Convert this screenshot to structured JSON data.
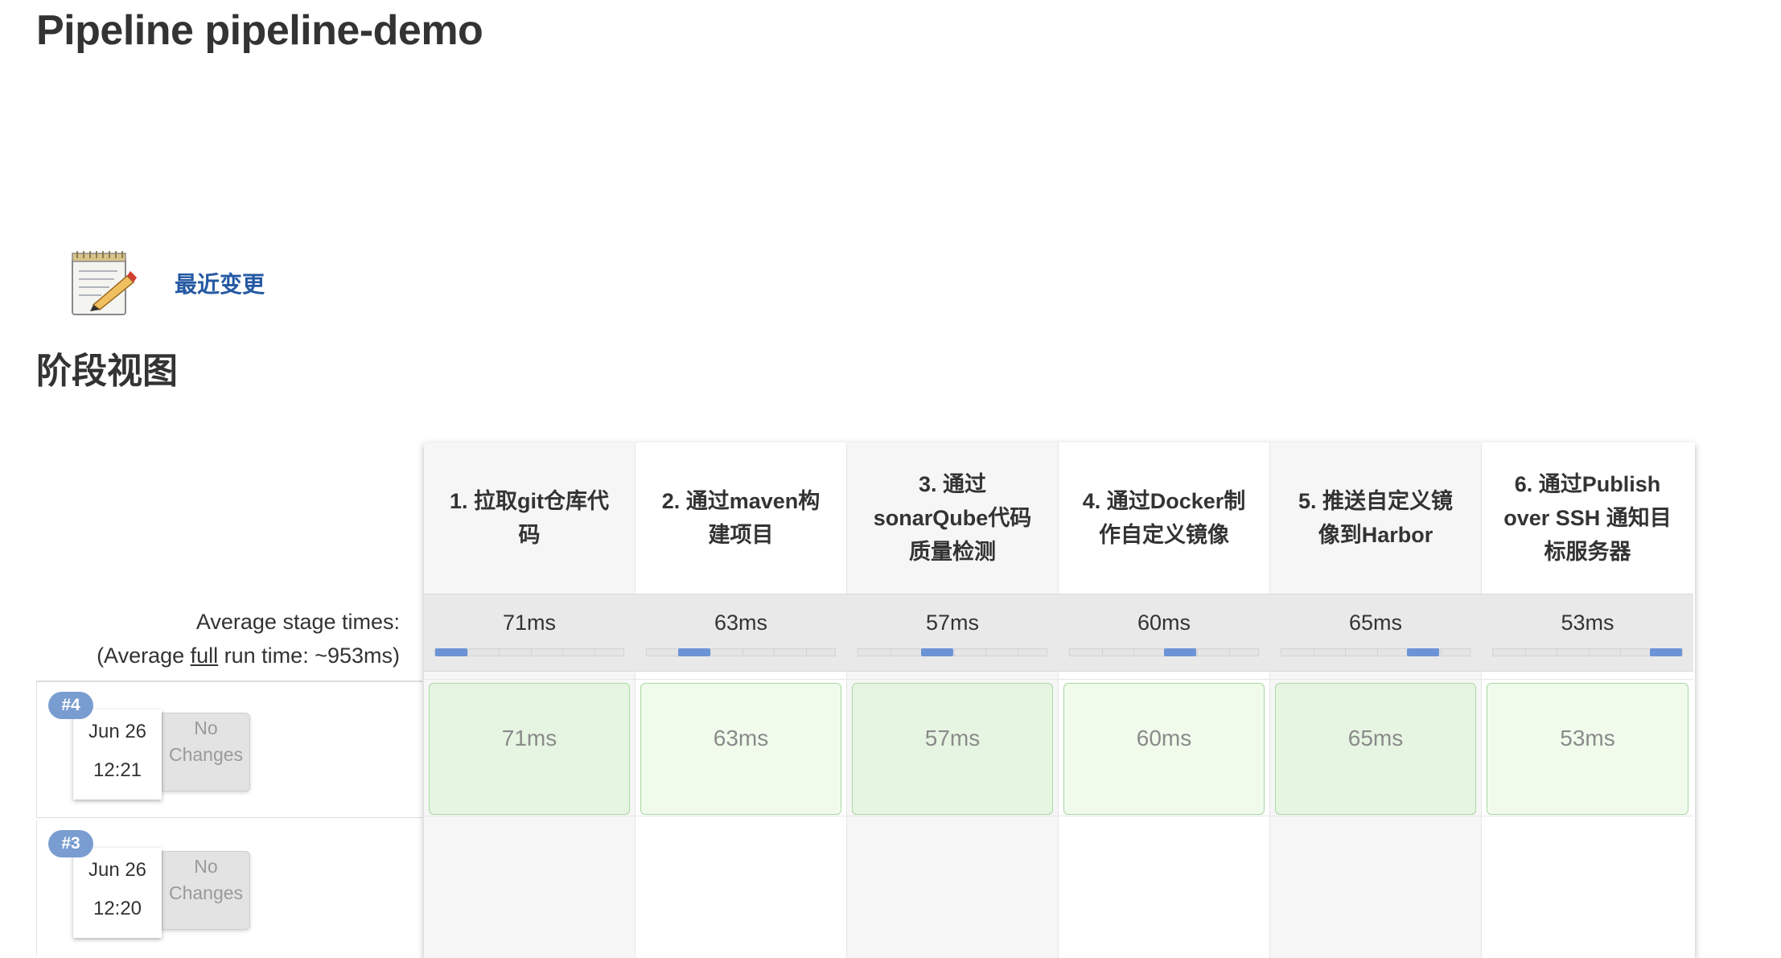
{
  "title": "Pipeline pipeline-demo",
  "recent_changes": {
    "label": "最近变更",
    "icon": "notepad-icon"
  },
  "stage_view": {
    "heading": "阶段视图",
    "avg_stage_label": "Average stage times:",
    "avg_full_prefix": "(Average ",
    "avg_full_link": "full",
    "avg_full_suffix": " run time: ~953ms)",
    "stages": [
      {
        "name": "1. 拉取git仓库代码",
        "avg": "71ms",
        "progress_pos": 0.0
      },
      {
        "name": "2. 通过maven构建项目",
        "avg": "63ms",
        "progress_pos": 0.2
      },
      {
        "name": "3. 通过sonarQube代码质量检测",
        "avg": "57ms",
        "progress_pos": 0.4
      },
      {
        "name": "4. 通过Docker制作自定义镜像",
        "avg": "60ms",
        "progress_pos": 0.6
      },
      {
        "name": "5. 推送自定义镜像到Harbor",
        "avg": "65ms",
        "progress_pos": 0.8
      },
      {
        "name": "6. 通过Publish over SSH 通知目标服务器",
        "avg": "53ms",
        "progress_pos": 1.0
      }
    ],
    "runs": [
      {
        "id": "#4",
        "date": "Jun 26",
        "time": "12:21",
        "changes": "No Changes",
        "durations": [
          "71ms",
          "63ms",
          "57ms",
          "60ms",
          "65ms",
          "53ms"
        ]
      },
      {
        "id": "#3",
        "date": "Jun 26",
        "time": "12:20",
        "changes": "No Changes",
        "durations": [
          "",
          "",
          "",
          "",
          "",
          ""
        ]
      }
    ]
  },
  "colors": {
    "link": "#2459a3",
    "badge": "#7a9dd1",
    "success_cell": "#e6f5e2",
    "success_border": "#a8d9a0",
    "progress_fill": "#6c93d6"
  }
}
